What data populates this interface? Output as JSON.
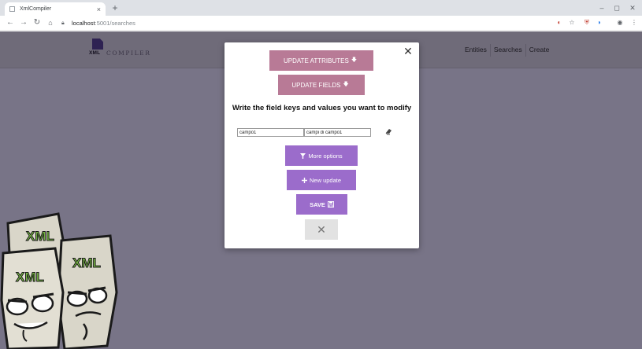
{
  "browser": {
    "tab_title": "XmlCompiler",
    "tab_close": "×",
    "new_tab": "+",
    "url_host": "localhost",
    "url_path": ":5001/searches",
    "window_controls": [
      "–",
      "◻",
      "✕"
    ]
  },
  "app": {
    "logo_xml": "XML",
    "logo_compiler": "COMPILER",
    "nav_links": [
      "Entities",
      "Searches",
      "Create"
    ]
  },
  "modal": {
    "update_attributes_label": "UPDATE ATTRIBUTES",
    "update_fields_label": "UPDATE FIELDS",
    "arrow_glyph": "🡇",
    "heading": "Write the field keys and values you want to modify",
    "field_key_value": "campo1",
    "field_value_value": "campi di campo1",
    "more_options_label": "More options",
    "new_update_label": "New update",
    "save_label": "SAVE",
    "cancel_glyph": "✕",
    "close_glyph": "✕"
  },
  "mascots": {
    "label": "XML"
  },
  "colors": {
    "accent_pink": "#b87a96",
    "accent_purple": "#9b6ccb",
    "overlay": "#787487"
  }
}
